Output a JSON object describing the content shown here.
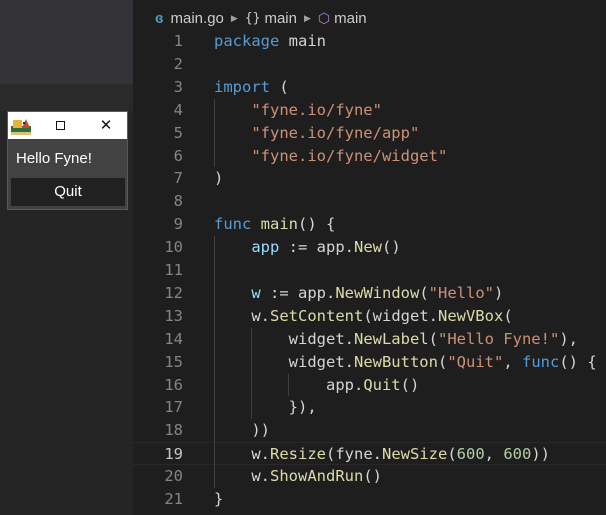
{
  "breadcrumb": {
    "file_icon": "go-file-icon",
    "file": "main.go",
    "package_icon": "braces-icon",
    "package": "main",
    "func_icon": "cube-icon",
    "func": "main"
  },
  "fyne_window": {
    "app_icon": "fyne-logo-icon",
    "label": "Hello Fyne!",
    "button": "Quit"
  },
  "editor": {
    "active_line": 19,
    "lines": [
      {
        "n": "1",
        "tokens": [
          [
            "kw",
            "package"
          ],
          [
            "pn",
            " main"
          ]
        ]
      },
      {
        "n": "2",
        "tokens": []
      },
      {
        "n": "3",
        "tokens": [
          [
            "kw",
            "import"
          ],
          [
            "pn",
            " ("
          ]
        ]
      },
      {
        "n": "4",
        "tokens": [
          [
            "pn",
            "    "
          ],
          [
            "str",
            "\"fyne.io/fyne\""
          ]
        ]
      },
      {
        "n": "5",
        "tokens": [
          [
            "pn",
            "    "
          ],
          [
            "str",
            "\"fyne.io/fyne/app\""
          ]
        ]
      },
      {
        "n": "6",
        "tokens": [
          [
            "pn",
            "    "
          ],
          [
            "str",
            "\"fyne.io/fyne/widget\""
          ]
        ]
      },
      {
        "n": "7",
        "tokens": [
          [
            "pn",
            ")"
          ]
        ]
      },
      {
        "n": "8",
        "tokens": []
      },
      {
        "n": "9",
        "tokens": [
          [
            "kw",
            "func"
          ],
          [
            "pn",
            " "
          ],
          [
            "fn",
            "main"
          ],
          [
            "pn",
            "() {"
          ]
        ]
      },
      {
        "n": "10",
        "tokens": [
          [
            "pn",
            "    "
          ],
          [
            "var",
            "app"
          ],
          [
            "pn",
            " := app."
          ],
          [
            "fn",
            "New"
          ],
          [
            "pn",
            "()"
          ]
        ]
      },
      {
        "n": "11",
        "tokens": []
      },
      {
        "n": "12",
        "tokens": [
          [
            "pn",
            "    "
          ],
          [
            "var",
            "w"
          ],
          [
            "pn",
            " := app."
          ],
          [
            "fn",
            "NewWindow"
          ],
          [
            "pn",
            "("
          ],
          [
            "str",
            "\"Hello\""
          ],
          [
            "pn",
            ")"
          ]
        ]
      },
      {
        "n": "13",
        "tokens": [
          [
            "pn",
            "    w."
          ],
          [
            "fn",
            "SetContent"
          ],
          [
            "pn",
            "(widget."
          ],
          [
            "fn",
            "NewVBox"
          ],
          [
            "pn",
            "("
          ]
        ]
      },
      {
        "n": "14",
        "tokens": [
          [
            "pn",
            "        widget."
          ],
          [
            "fn",
            "NewLabel"
          ],
          [
            "pn",
            "("
          ],
          [
            "str",
            "\"Hello Fyne!\""
          ],
          [
            "pn",
            "),"
          ]
        ]
      },
      {
        "n": "15",
        "tokens": [
          [
            "pn",
            "        widget."
          ],
          [
            "fn",
            "NewButton"
          ],
          [
            "pn",
            "("
          ],
          [
            "str",
            "\"Quit\""
          ],
          [
            "pn",
            ", "
          ],
          [
            "kw",
            "func"
          ],
          [
            "pn",
            "() {"
          ]
        ]
      },
      {
        "n": "16",
        "tokens": [
          [
            "pn",
            "            app."
          ],
          [
            "fn",
            "Quit"
          ],
          [
            "pn",
            "()"
          ]
        ]
      },
      {
        "n": "17",
        "tokens": [
          [
            "pn",
            "        }),"
          ]
        ]
      },
      {
        "n": "18",
        "tokens": [
          [
            "pn",
            "    ))"
          ]
        ]
      },
      {
        "n": "19",
        "tokens": [
          [
            "pn",
            "    w."
          ],
          [
            "fn",
            "Resize"
          ],
          [
            "pn",
            "(fyne."
          ],
          [
            "fn",
            "NewSize"
          ],
          [
            "pn",
            "("
          ],
          [
            "num",
            "600"
          ],
          [
            "pn",
            ", "
          ],
          [
            "num",
            "600"
          ],
          [
            "pn",
            "))"
          ]
        ]
      },
      {
        "n": "20",
        "tokens": [
          [
            "pn",
            "    w."
          ],
          [
            "fn",
            "ShowAndRun"
          ],
          [
            "pn",
            "()"
          ]
        ]
      },
      {
        "n": "21",
        "tokens": [
          [
            "pn",
            "}"
          ]
        ]
      }
    ]
  }
}
